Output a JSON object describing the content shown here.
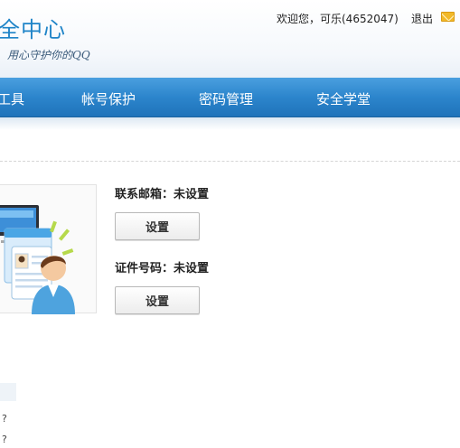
{
  "header": {
    "logo_title": "全中心",
    "logo_subtitle": "用心守护你的QQ",
    "welcome": "欢迎您，可乐(4652047)",
    "logout": "退出",
    "mail_icon": "envelope-icon"
  },
  "nav": {
    "items": [
      {
        "label": "工具"
      },
      {
        "label": "帐号保护"
      },
      {
        "label": "密码管理"
      },
      {
        "label": "安全学堂"
      }
    ]
  },
  "info": {
    "email_label": "联系邮箱：未设置",
    "email_button": "设置",
    "id_label": "证件号码：未设置",
    "id_button": "设置"
  },
  "sidebar_marks": [
    "?",
    "?"
  ],
  "colors": {
    "nav": "#2c85cc",
    "logo": "#1f84c8",
    "mail": "#f2b928"
  }
}
